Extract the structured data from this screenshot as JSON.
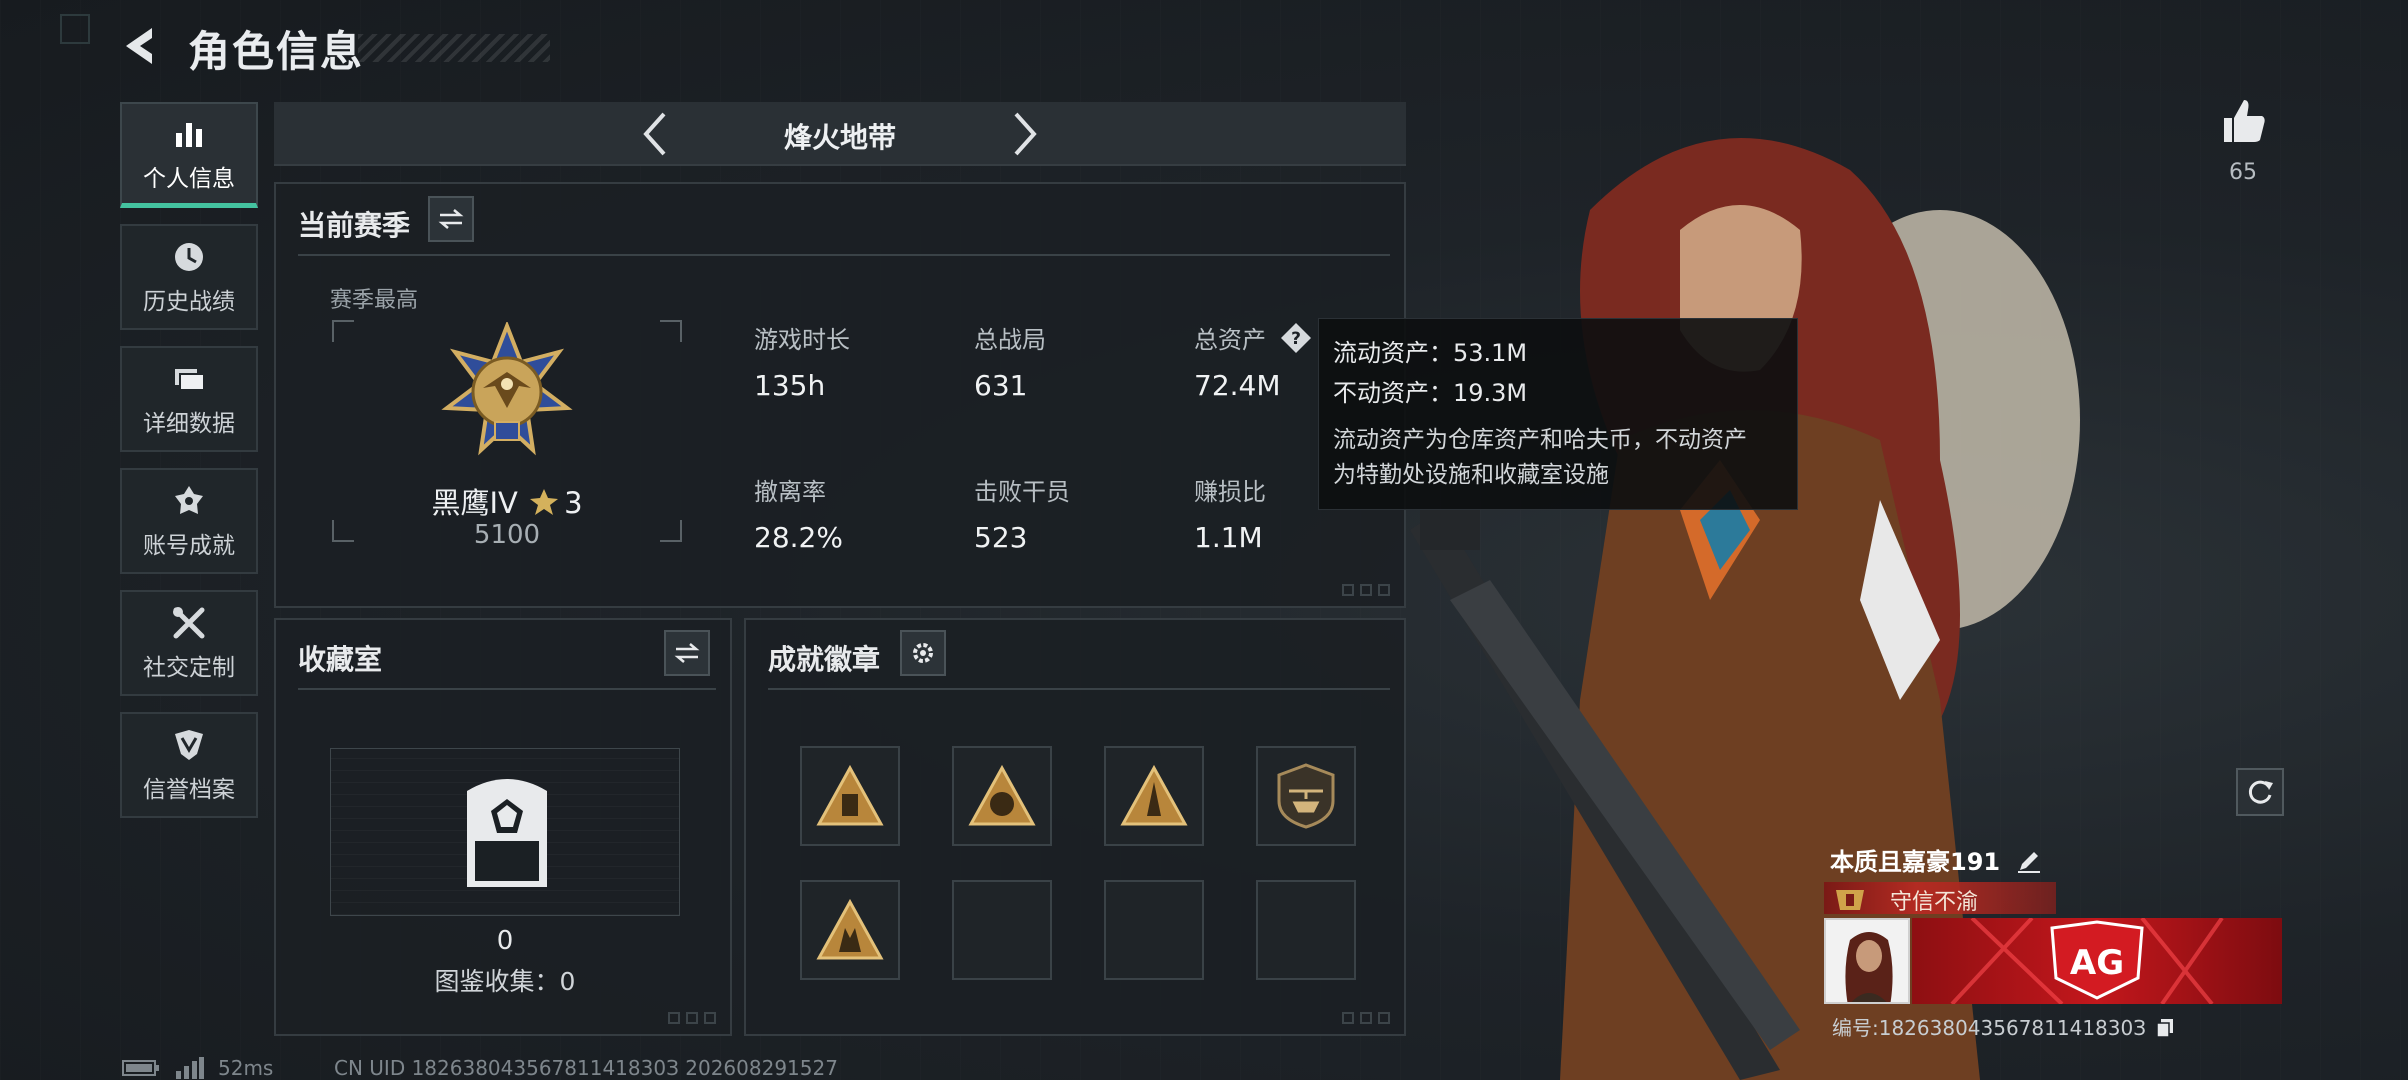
{
  "header": {
    "title": "角色信息"
  },
  "sidebar": {
    "items": [
      {
        "label": "个人信息",
        "icon": "bar-chart-icon",
        "active": true
      },
      {
        "label": "历史战绩",
        "icon": "clock-icon"
      },
      {
        "label": "详细数据",
        "icon": "folder-icon"
      },
      {
        "label": "账号成就",
        "icon": "trophy-icon"
      },
      {
        "label": "社交定制",
        "icon": "tools-icon"
      },
      {
        "label": "信誉档案",
        "icon": "shield-icon"
      }
    ]
  },
  "mode": {
    "title": "烽火地带"
  },
  "season": {
    "title": "当前赛季",
    "best_label": "赛季最高",
    "rank_name": "黑鹰IV",
    "rank_stars": "3",
    "rank_score": "5100",
    "stats": [
      {
        "label": "游戏时长",
        "value": "135h"
      },
      {
        "label": "总战局",
        "value": "631"
      },
      {
        "label": "总资产",
        "value": "72.4M",
        "help": true
      },
      {
        "label": "撤离率",
        "value": "28.2%"
      },
      {
        "label": "击败干员",
        "value": "523"
      },
      {
        "label": "赚损比",
        "value": "1.1M"
      }
    ]
  },
  "tooltip": {
    "liquid": "流动资产：53.1M",
    "fixed": "不动资产：19.3M",
    "desc_line1": "流动资产为仓库资产和哈夫币，不动资产",
    "desc_line2": "为特勤处设施和收藏室设施"
  },
  "collection": {
    "title": "收藏室",
    "count": "0",
    "index_label": "图鉴收集：0"
  },
  "achievements": {
    "title": "成就徽章",
    "badges": [
      "triangle-badge-icon",
      "triangle-badge-icon",
      "triangle-badge-icon",
      "helicopter-badge-icon",
      "triangle-badge-icon",
      "",
      "",
      ""
    ]
  },
  "profile": {
    "likes": "65",
    "name": "本质且嘉豪191",
    "motto": "守信不渝",
    "id_text": "编号:18263804356781141830З",
    "team_logo": "AG"
  },
  "footer": {
    "ping": "52ms",
    "uid": "CN UID 18263804356781141830З 202608291527"
  },
  "colors": {
    "accent": "#44c3a0",
    "gold": "#c9a45a",
    "banner_red": "#c3171c"
  }
}
